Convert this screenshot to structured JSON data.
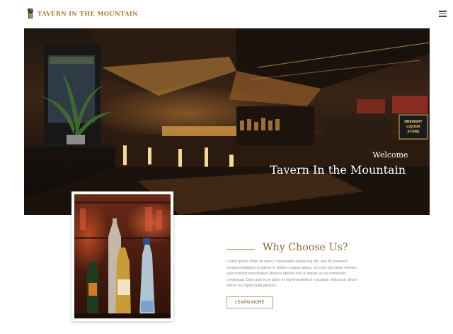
{
  "header": {
    "logo_text": "TAVERN IN THE MOUNTAIN",
    "logo_icon": "tavern-logo-icon",
    "menu_icon": "hamburger-menu-icon"
  },
  "hero": {
    "welcome": "Welcome",
    "title": "Tavern In the Mountain",
    "sign_text": "BREWERY LIQUOR STORE"
  },
  "why": {
    "title": "Why Choose Us?",
    "body": "Lorem ipsum dolor sit amet, consectetur adipiscing elit, sed do eiusmod tempor incididunt ut labore et dolore magna aliqua. Ut enim ad minim veniam, quis nostrud exercitation ullamco laboris nisi ut aliquip ex ea commodo consequat. Duis aute irure dolor in reprehenderit in voluptate velit esse cillum dolore eu fugiat nulla pariatur.",
    "button_label": "LEARN MORE"
  },
  "photo": {
    "bottle_label": "Jägermeister"
  },
  "colors": {
    "accent_gold": "#9c7a34",
    "title_brown": "#8a6a2f",
    "body_gray": "#8b8b8b"
  }
}
